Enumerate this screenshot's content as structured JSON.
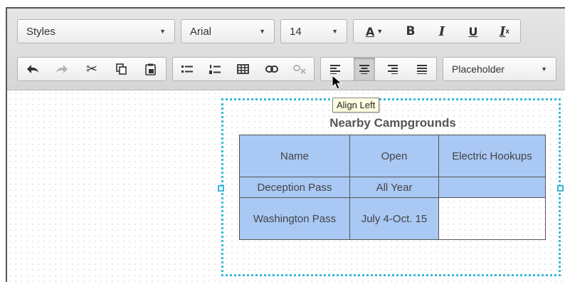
{
  "toolbar": {
    "row1": {
      "styles_label": "Styles",
      "font_label": "Arial",
      "size_label": "14",
      "text_color_label": "A",
      "bold_label": "B",
      "italic_label": "I",
      "underline_label": "U",
      "clear_format_label": "I",
      "clear_format_sub": "x"
    },
    "row2": {
      "placeholder_label": "Placeholder"
    }
  },
  "tooltip": "Align Left",
  "table": {
    "caption": "Nearby Campgrounds",
    "headers": [
      "Name",
      "Open",
      "Electric Hookups"
    ],
    "rows": [
      [
        "Deception Pass",
        "All Year",
        ""
      ],
      [
        "Washington Pass",
        "July 4-Oct. 15",
        ""
      ]
    ]
  },
  "colors": {
    "selection": "#a9c8f4",
    "selection_border": "#3ab8d9"
  }
}
